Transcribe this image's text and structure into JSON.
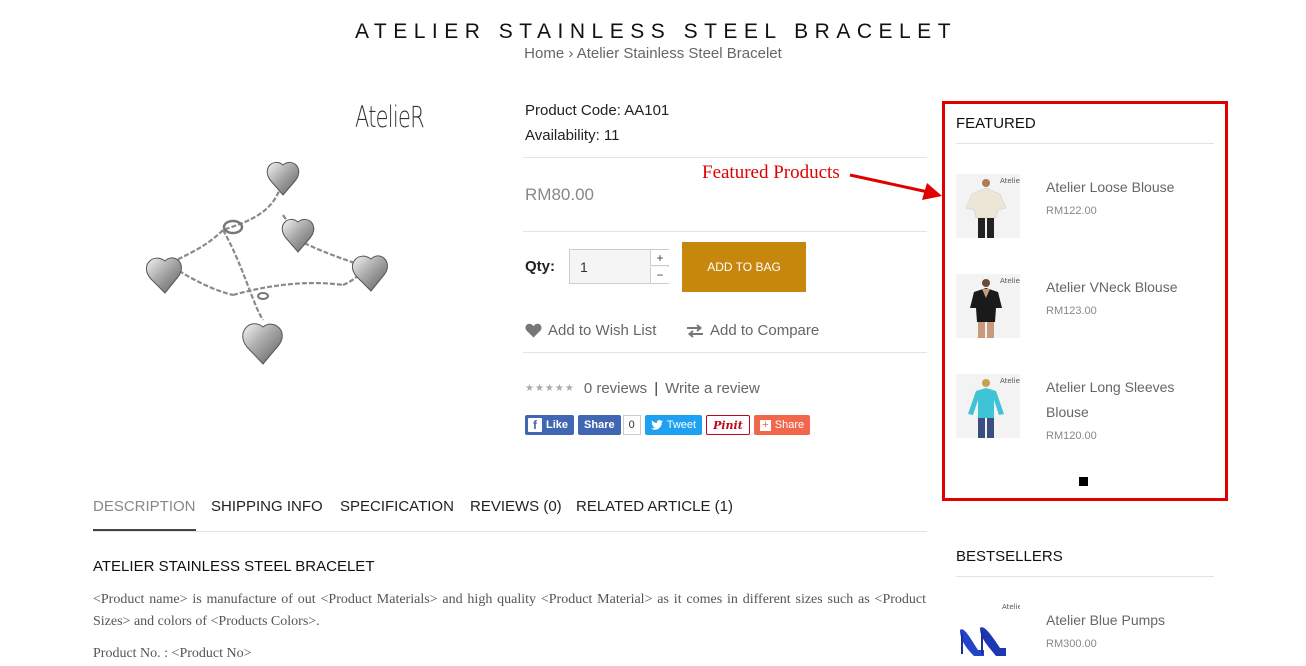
{
  "page": {
    "title": "ATELIER STAINLESS STEEL BRACELET",
    "breadcrumb": {
      "home": "Home",
      "separator": "›",
      "current": "Atelier Stainless Steel Bracelet"
    }
  },
  "brand": {
    "logo_text": "AtelieR"
  },
  "product": {
    "code_line": "Product Code: AA101",
    "availability_line": "Availability: 11",
    "price": "RM80.00",
    "qty_label": "Qty:",
    "qty_value": "1",
    "qty_plus": "+",
    "qty_minus": "−",
    "add_to_bag": "ADD TO BAG",
    "wishlist": "Add to Wish List",
    "compare": "Add to Compare",
    "reviews": "0 reviews",
    "review_separator": "|",
    "write_review": "Write a review"
  },
  "share": {
    "fb_like": "Like",
    "fb_share": "Share",
    "count": "0",
    "tweet": "Tweet",
    "pin": "Pinit",
    "gplus": "Share"
  },
  "tabs": [
    {
      "label": "DESCRIPTION",
      "active": true
    },
    {
      "label": "SHIPPING INFO"
    },
    {
      "label": "SPECIFICATION"
    },
    {
      "label": "REVIEWS (0)"
    },
    {
      "label": "RELATED ARTICLE (1)"
    }
  ],
  "description": {
    "title": "ATELIER STAINLESS STEEL BRACELET",
    "paragraph": "<Product name> is manufacture of out <Product Materials> and high quality <Product Material> as it comes in different sizes such as <Product Sizes> and colors of <Products Colors>.",
    "product_no": "Product No. : <Product No>"
  },
  "featured": {
    "heading": "FEATURED",
    "items": [
      {
        "name": "Atelier Loose Blouse",
        "price": "RM122.00",
        "image_icon": "cream-blouse"
      },
      {
        "name": "Atelier VNeck Blouse",
        "price": "RM123.00",
        "image_icon": "black-blouse"
      },
      {
        "name": "Atelier Long Sleeves Blouse",
        "price": "RM120.00",
        "image_icon": "turquoise-blouse"
      }
    ]
  },
  "bestsellers": {
    "heading": "BESTSELLERS",
    "items": [
      {
        "name": "Atelier Blue Pumps",
        "price": "RM300.00",
        "image_icon": "blue-pumps"
      }
    ]
  },
  "annotation": {
    "text": "Featured Products",
    "color": "#e00000"
  },
  "colors": {
    "accent": "#c6870c",
    "highlight": "#e00000",
    "facebook": "#4267b2",
    "twitter": "#1da1f2"
  }
}
